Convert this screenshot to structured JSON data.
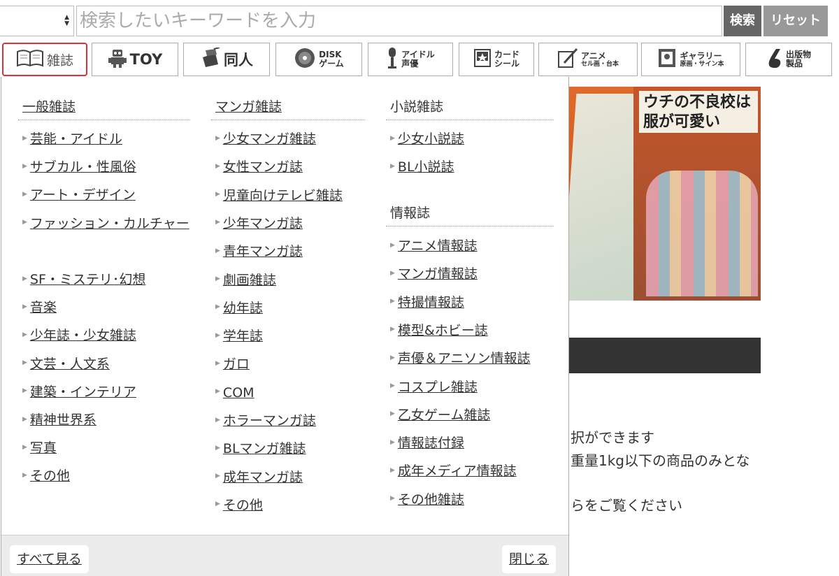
{
  "search": {
    "placeholder": "検索したいキーワードを入力",
    "search_label": "検索",
    "reset_label": "リセット"
  },
  "categories": [
    {
      "label": "雑誌",
      "icon": "book-icon",
      "active": true
    },
    {
      "label": "TOY",
      "icon": "robot-icon"
    },
    {
      "label": "同人",
      "icon": "doujin-icon"
    },
    {
      "label": "DISK",
      "label2": "ゲーム",
      "icon": "disk-icon"
    },
    {
      "label": "アイドル",
      "label2": "声優",
      "icon": "microphone-icon"
    },
    {
      "label": "カード",
      "label2": "シール",
      "icon": "card-icon"
    },
    {
      "label": "アニメ",
      "label2": "セル画・台本",
      "icon": "pen-icon"
    },
    {
      "label": "ギャラリー",
      "label2": "原画・サイン本",
      "icon": "frame-icon"
    },
    {
      "label": "出版物",
      "label2": "製品",
      "icon": "publication-icon"
    }
  ],
  "menu": {
    "col1": {
      "heading": "一般雑誌",
      "items": [
        "芸能・アイドル",
        "サブカル・性風俗",
        "アート・デザイン",
        "ファッション・カルチャー",
        "SF・ミステリ･幻想",
        "音楽",
        "少年誌・少女雑誌",
        "文芸・人文系",
        "建築・インテリア",
        "精神世界系",
        "写真",
        "その他"
      ]
    },
    "col2": {
      "heading": "マンガ雑誌",
      "items": [
        "少女マンガ雑誌",
        "女性マンガ誌",
        "児童向けテレビ雑誌",
        "少年マンガ誌",
        "青年マンガ誌",
        "劇画雑誌",
        "幼年誌",
        "学年誌",
        "ガロ",
        "COM",
        "ホラーマンガ誌",
        "BLマンガ雑誌",
        "成年マンガ誌",
        "その他"
      ]
    },
    "col3a": {
      "heading": "小説雑誌",
      "items": [
        "少女小説誌",
        "BL小説誌"
      ]
    },
    "col3b": {
      "heading": "情報誌",
      "items": [
        "アニメ情報誌",
        "マンガ情報誌",
        "特撮情報誌",
        "模型&ホビー誌",
        "声優＆アニソン情報誌",
        "コスプレ雑誌",
        "乙女ゲーム雑誌",
        "情報誌付録",
        "成年メディア情報誌",
        "その他雑誌"
      ]
    },
    "see_all": "すべて見る",
    "close": "閉じる"
  },
  "banner": {
    "title": "ウチの不良校は\n服が可愛い"
  },
  "background_text": [
    "択ができます",
    "重量1kg以下の商品のみとな",
    "らをご覧ください"
  ]
}
